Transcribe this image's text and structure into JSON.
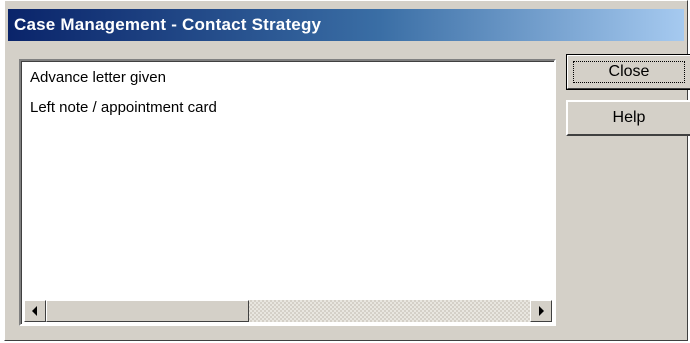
{
  "window": {
    "title": "Case Management - Contact Strategy"
  },
  "list": {
    "items": [
      "Advance letter given",
      "Left note / appointment card"
    ]
  },
  "buttons": {
    "close_label": "Close",
    "help_label": "Help"
  },
  "icons": {
    "scroll_left": "left-arrow-icon",
    "scroll_right": "right-arrow-icon"
  },
  "colors": {
    "title_start": "#0a246a",
    "title_end": "#a6caf0",
    "dialog_face": "#d4d0c8"
  }
}
